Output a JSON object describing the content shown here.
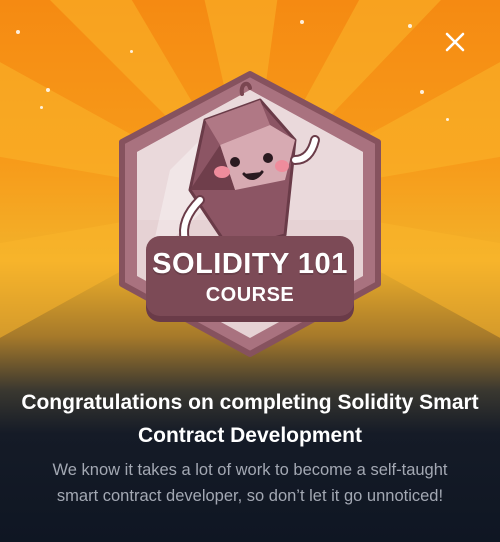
{
  "modal": {
    "close_label": "×",
    "badge": {
      "title": "SOLIDITY 101",
      "subtitle": "COURSE",
      "mascot_icon": "smiling-gem-mascot-icon"
    },
    "headline": "Congratulations on completing Solidity Smart Contract Development",
    "description": "We know it takes a lot of work to become a self-taught smart contract developer, so don’t let it go unnoticed!"
  },
  "colors": {
    "top_background": "#f58a12",
    "bottom_background": "#0f1623",
    "badge_border": "#9b5e6c",
    "badge_fill": "#7c4a56",
    "headline_text": "#ffffff",
    "description_text": "#a3a8b3"
  }
}
